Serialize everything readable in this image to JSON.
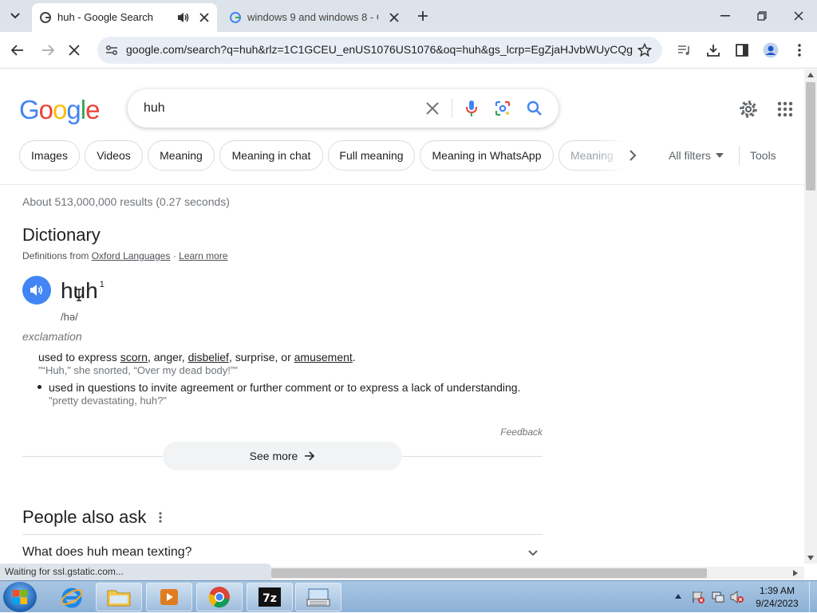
{
  "tabs": [
    {
      "title": "huh - Google Search",
      "active": true
    },
    {
      "title": "windows 9 and windows 8 - Go",
      "active": false
    }
  ],
  "address_bar": {
    "url": "google.com/search?q=huh&rlz=1C1GCEU_enUS1076US1076&oq=huh&gs_lcrp=EgZjaHJvbWUyCQg..."
  },
  "search": {
    "query": "huh"
  },
  "filters": {
    "chips": [
      "Images",
      "Videos",
      "Meaning",
      "Meaning in chat",
      "Full meaning",
      "Meaning in WhatsApp",
      "Meaning"
    ],
    "all_filters": "All filters",
    "tools": "Tools"
  },
  "results_stats": "About 513,000,000 results (0.27 seconds)",
  "dictionary": {
    "heading": "Dictionary",
    "source_prefix": "Definitions from",
    "source": "Oxford Languages",
    "separator": "·",
    "learn_more": "Learn more",
    "word": "huh",
    "superscript": "1",
    "phonetic": "/hə/",
    "pos": "exclamation",
    "def1_a": "used to express ",
    "def1_scorn": "scorn",
    "def1_b": ", anger, ",
    "def1_disbelief": "disbelief",
    "def1_c": ", surprise, or ",
    "def1_amusement": "amusement",
    "def1_d": ".",
    "def1_example": "\"“Huh,” she snorted, “Over my dead body!”\"",
    "def2": "used in questions to invite agreement or further comment or to express a lack of understanding.",
    "def2_example": "\"pretty devastating, huh?\"",
    "feedback": "Feedback",
    "see_more": "See more"
  },
  "people_also_ask": {
    "heading": "People also ask",
    "q1": "What does huh mean texting?"
  },
  "status_bar": "Waiting for ssl.gstatic.com...",
  "taskbar": {
    "time": "1:39 AM",
    "date": "9/24/2023"
  },
  "colors": {
    "google_blue": "#4285f4",
    "google_red": "#ea4335",
    "google_yellow": "#fbbc05",
    "google_green": "#34a853"
  }
}
